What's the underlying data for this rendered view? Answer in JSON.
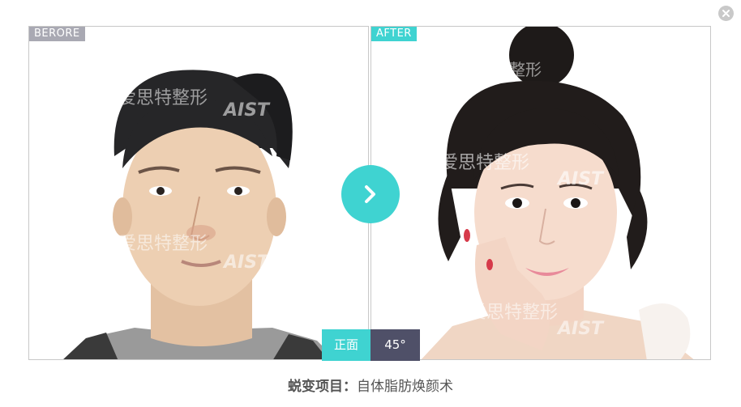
{
  "close_icon": "close-icon",
  "before": {
    "tag": "BERORE",
    "watermark_cn": "爱思特整形",
    "watermark_en": "AIST"
  },
  "after": {
    "tag": "AFTER",
    "watermark_cn": "爱思特整形",
    "watermark_en": "AIST"
  },
  "next_icon": "chevron-right-icon",
  "view_tabs": {
    "front": "正面",
    "angle": "45°"
  },
  "caption": {
    "label": "蜕变项目：",
    "value": "自体脂肪焕颜术"
  },
  "colors": {
    "accent": "#3fd3d1",
    "dark_tab": "#4f5068",
    "before_tag": "#a9a9b3"
  }
}
